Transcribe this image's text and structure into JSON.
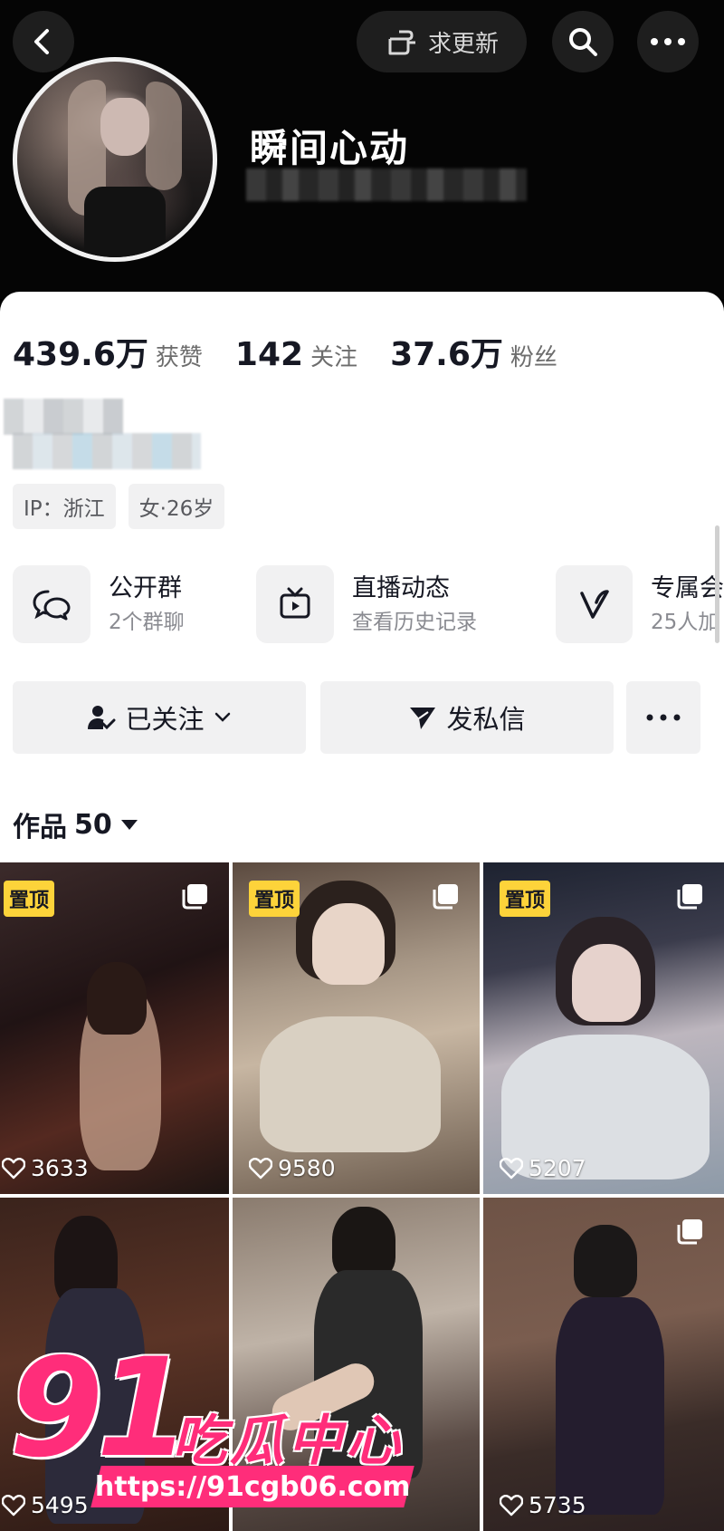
{
  "header": {
    "request_update_label": "求更新",
    "username": "瞬间心动"
  },
  "stats": [
    {
      "value": "439.6万",
      "label": "获赞"
    },
    {
      "value": "142",
      "label": "关注"
    },
    {
      "value": "37.6万",
      "label": "粉丝"
    }
  ],
  "tags": [
    "IP：浙江",
    "女·26岁"
  ],
  "features": [
    {
      "title": "公开群",
      "subtitle": "2个群聊",
      "icon": "group-chat-icon"
    },
    {
      "title": "直播动态",
      "subtitle": "查看历史记录",
      "icon": "tv-icon"
    },
    {
      "title": "专属会",
      "subtitle": "25人加",
      "icon": "v-icon"
    }
  ],
  "actions": {
    "follow_label": "已关注",
    "message_label": "发私信"
  },
  "works": {
    "label": "作品",
    "count": "50"
  },
  "videos": [
    {
      "likes": "3633",
      "pinned": "置顶",
      "multi": true
    },
    {
      "likes": "9580",
      "pinned": "置顶",
      "multi": true
    },
    {
      "likes": "5207",
      "pinned": "置顶",
      "multi": true
    },
    {
      "likes": "5495",
      "pinned": "",
      "multi": false
    },
    {
      "likes": "",
      "pinned": "",
      "multi": false
    },
    {
      "likes": "5735",
      "pinned": "",
      "multi": true
    }
  ],
  "watermark": {
    "number": "91",
    "text": "吃瓜中心",
    "url": "https://91cgb06.com"
  },
  "colors": {
    "pin_badge": "#fdd33a",
    "watermark": "#ff2d7a",
    "header_bg": "#050505"
  }
}
